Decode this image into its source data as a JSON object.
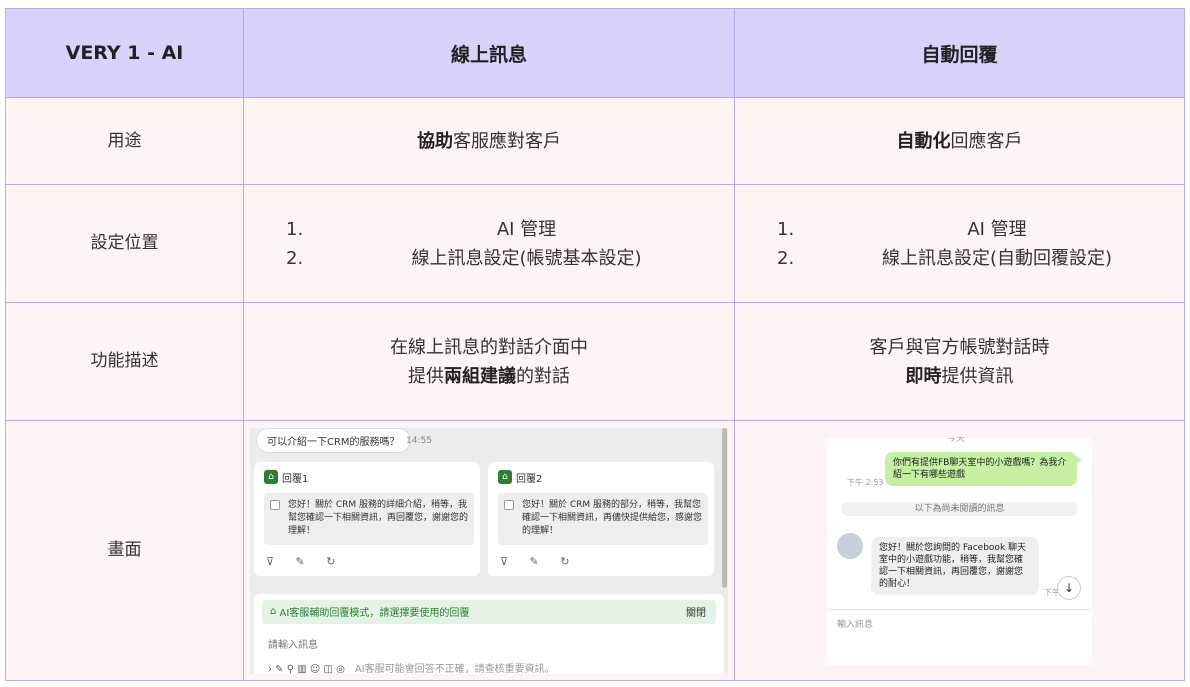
{
  "header": {
    "col1": "VERY 1 - AI",
    "col2": "線上訊息",
    "col3": "自動回覆"
  },
  "rows": {
    "purpose": {
      "label": "用途",
      "col2_bold": "協助",
      "col2_rest": "客服應對客戶",
      "col3_bold": "自動化",
      "col3_rest": "回應客戶"
    },
    "location": {
      "label": "設定位置",
      "col2": [
        {
          "num": "1.",
          "text": "AI 管理"
        },
        {
          "num": "2.",
          "text": "線上訊息設定(帳號基本設定)"
        }
      ],
      "col3": [
        {
          "num": "1.",
          "text": "AI 管理"
        },
        {
          "num": "2.",
          "text": "線上訊息設定(自動回覆設定)"
        }
      ]
    },
    "description": {
      "label": "功能描述",
      "col2_line1": "在線上訊息的對話介面中",
      "col2_line2_pre": "提供",
      "col2_line2_bold": "兩組建議",
      "col2_line2_post": "的對話",
      "col3_line1": "客戶與官方帳號對話時",
      "col3_line2_bold": "即時",
      "col3_line2_post": "提供資訊"
    },
    "screen": {
      "label": "畫面"
    }
  },
  "shot1": {
    "user_msg": "可以介紹一下CRM的服務嗎？",
    "time": "14:55",
    "reply1_title": "回覆1",
    "reply1_body": "您好！關於 CRM 服務的詳細介紹，稍等，我幫您確認一下相關資訊，再回覆您，謝謝您的理解！",
    "reply2_title": "回覆2",
    "reply2_body": "您好！關於 CRM 服務的部分，稍等，我幫您確認一下相關資訊，再儘快提供給您，感謝您的理解！",
    "card_icons": "⊽ ✎ ↻",
    "mode_text": "AI客服輔助回覆模式，請選擇要使用的回覆",
    "mode_close": "關閉",
    "input_placeholder": "請輸入訊息",
    "tools": "› ✎ ⚲ ▥ ☺ ◫ ◎",
    "tools_note": "AI客服可能會回答不正確，請查核重要資訊。"
  },
  "shot2": {
    "top_fragment": "今天",
    "out_msg": "你們有提供FB聊天室中的小遊戲嗎？為我介紹一下有哪些遊戲",
    "out_time": "下午 2:53",
    "divider": "以下為尚未閱讀的訊息",
    "in_msg": "您好！關於您詢問的 Facebook 聊天室中的小遊戲功能，稍等，我幫您確認一下相關資訊，再回覆您，謝謝您的耐心！",
    "in_time": "下午",
    "down_icon": "↓",
    "input_placeholder": "輸入訊息"
  },
  "colors": {
    "header_bg": "#d9d2fb",
    "cell_bg": "#fdf5f4",
    "border": "#b9ace6",
    "brand_green": "#2e7d32",
    "outgoing_bubble": "#c5f0a4"
  }
}
